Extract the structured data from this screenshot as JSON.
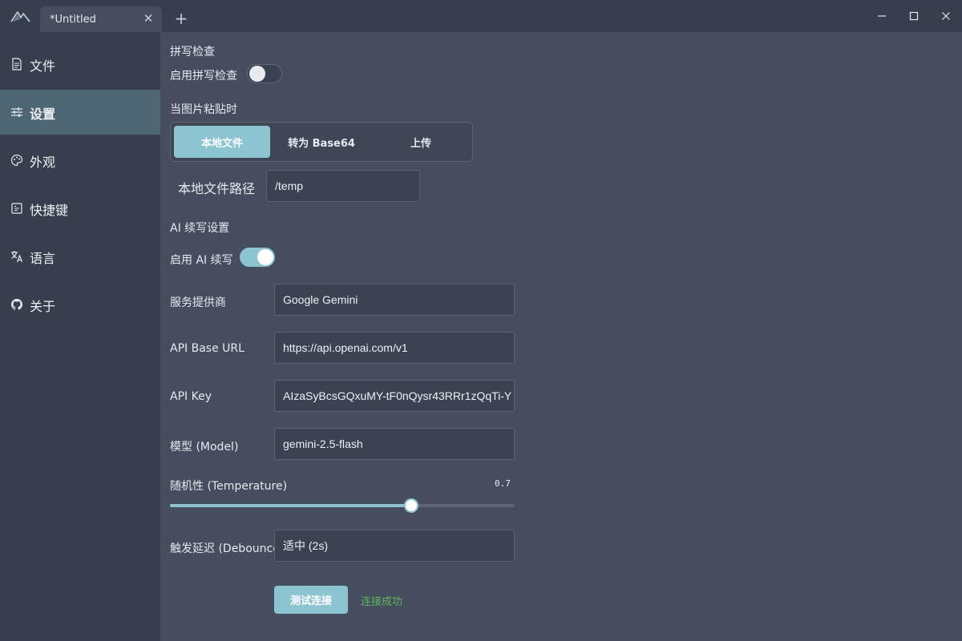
{
  "titlebar": {
    "tab_title": "*Untitled",
    "tab_close": "✕",
    "new_tab": "+"
  },
  "sidebar": {
    "items": [
      {
        "label": "文件",
        "icon": "file-icon"
      },
      {
        "label": "设置",
        "icon": "sliders-icon",
        "active": true
      },
      {
        "label": "外观",
        "icon": "palette-icon"
      },
      {
        "label": "快捷键",
        "icon": "keyboard-icon"
      },
      {
        "label": "语言",
        "icon": "translate-icon"
      },
      {
        "label": "关于",
        "icon": "github-icon"
      }
    ]
  },
  "spellcheck": {
    "section_title": "拼写检查",
    "toggle_label": "启用拼写检查",
    "enabled": false
  },
  "image_paste": {
    "section_title": "当图片粘贴时",
    "options": [
      "本地文件",
      "转为 Base64",
      "上传"
    ],
    "selected": "本地文件",
    "path_label": "本地文件路径",
    "path_value": "/temp"
  },
  "ai": {
    "section_title": "AI 续写设置",
    "toggle_label": "启用 AI 续写",
    "enabled": true,
    "provider_label": "服务提供商",
    "provider_value": "Google Gemini",
    "base_url_label": "API Base URL",
    "base_url_value": "https://api.openai.com/v1",
    "api_key_label": "API Key",
    "api_key_value": "AIzaSyBcsGQxuMY-tF0nQysr43RRr1zQqTi-Y",
    "model_label": "模型 (Model)",
    "model_value": "gemini-2.5-flash",
    "temperature_label": "随机性 (Temperature)",
    "temperature_value": "0.7",
    "temperature": 0.7,
    "debounce_label": "触发延迟 (Debounce)",
    "debounce_value": "适中 (2s)",
    "test_button": "测试连接",
    "status_text": "连接成功"
  },
  "colors": {
    "accent": "#8cc4d2",
    "success": "#5cb85c",
    "sidebar_active": "#4d6673"
  }
}
